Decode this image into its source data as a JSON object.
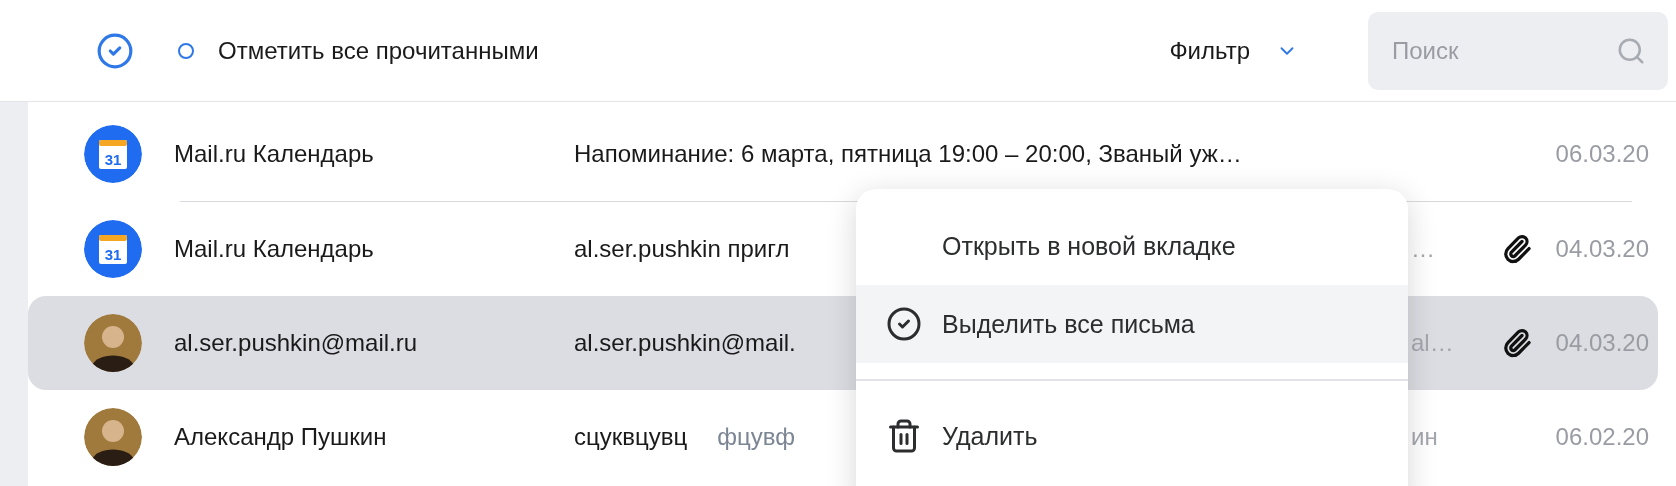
{
  "toolbar": {
    "mark_all_read": "Отметить все прочитанными",
    "filter": "Фильтр",
    "search": {
      "placeholder": "Поиск"
    }
  },
  "messages": [
    {
      "avatar": {
        "kind": "calendar",
        "day": "31"
      },
      "sender": "Mail.ru Календарь",
      "subject": "Напоминание: 6 марта, пятница 19:00 – 20:00, Званый уж…",
      "attachment": false,
      "date": "06.03.20",
      "selected": false
    },
    {
      "avatar": {
        "kind": "calendar",
        "day": "31"
      },
      "sender": "Mail.ru Календарь",
      "subject": "al.ser.pushkin пригл",
      "tail": "…",
      "attachment": true,
      "date": "04.03.20",
      "selected": false
    },
    {
      "avatar": {
        "kind": "person"
      },
      "sender": "al.ser.pushkin@mail.ru",
      "subject": "al.ser.pushkin@mail.",
      "tail": "al…",
      "attachment": true,
      "date": "04.03.20",
      "selected": true
    },
    {
      "avatar": {
        "kind": "person"
      },
      "sender": "Александр Пушкин",
      "subject": "сцуквцувц",
      "preview": "фцувф",
      "tail": "ин",
      "attachment": false,
      "date": "06.02.20",
      "selected": false
    }
  ],
  "context_menu": [
    {
      "label": "Открыть в новой вкладке",
      "kind": "plain",
      "selected": false
    },
    {
      "label": "Выделить все письма",
      "kind": "check",
      "selected": true
    },
    {
      "label": "Удалить",
      "kind": "trash",
      "selected": false
    }
  ]
}
